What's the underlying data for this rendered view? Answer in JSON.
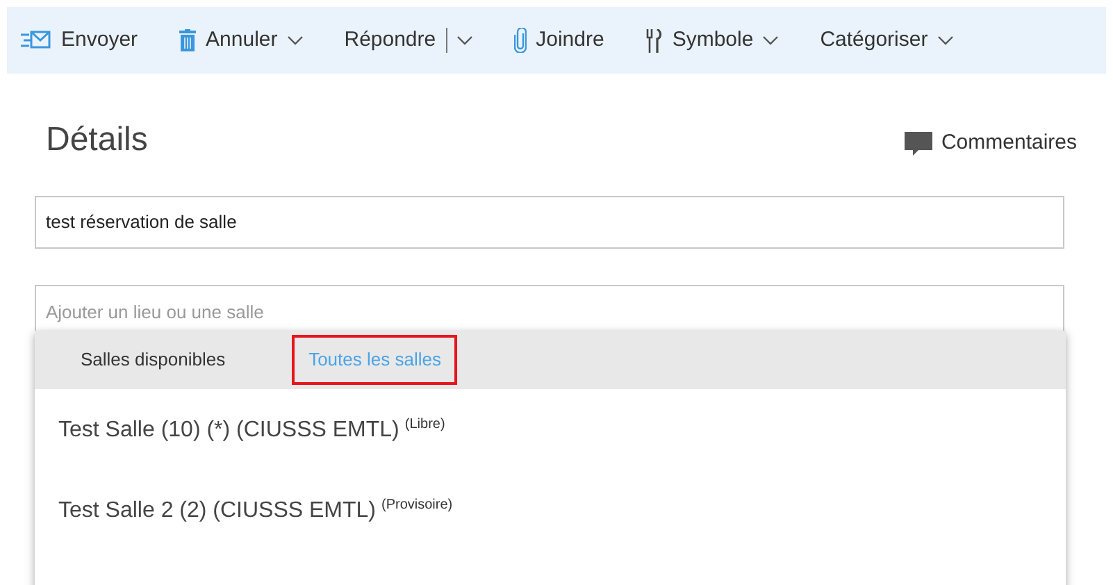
{
  "toolbar": [
    {
      "kind": "send",
      "label": "Envoyer",
      "dropdown": false
    },
    {
      "kind": "delete",
      "label": "Annuler",
      "dropdown": true
    },
    {
      "kind": "reply",
      "label": "Répondre",
      "dropdown": true
    },
    {
      "kind": "attach",
      "label": "Joindre",
      "dropdown": false
    },
    {
      "kind": "flag",
      "label": "Symbole",
      "dropdown": true
    },
    {
      "kind": "categorize",
      "label": "Catégoriser",
      "dropdown": true
    }
  ],
  "details": {
    "title": "Détails",
    "comments": "Commentaires",
    "subject": "test réservation de salle",
    "location": {
      "placeholder": "Ajouter un lieu ou une salle"
    }
  },
  "room_picker": {
    "tabs": [
      {
        "label": "Salles disponibles",
        "selected": false,
        "highlighted": false
      },
      {
        "label": "Toutes les salles",
        "selected": true,
        "highlighted": true
      }
    ],
    "rooms": [
      {
        "name": "Test Salle (10) (*) (CIUSSS EMTL)",
        "status": "(Libre)"
      },
      {
        "name": "Test Salle 2 (2) (CIUSSS EMTL)",
        "status": "(Provisoire)"
      }
    ]
  }
}
